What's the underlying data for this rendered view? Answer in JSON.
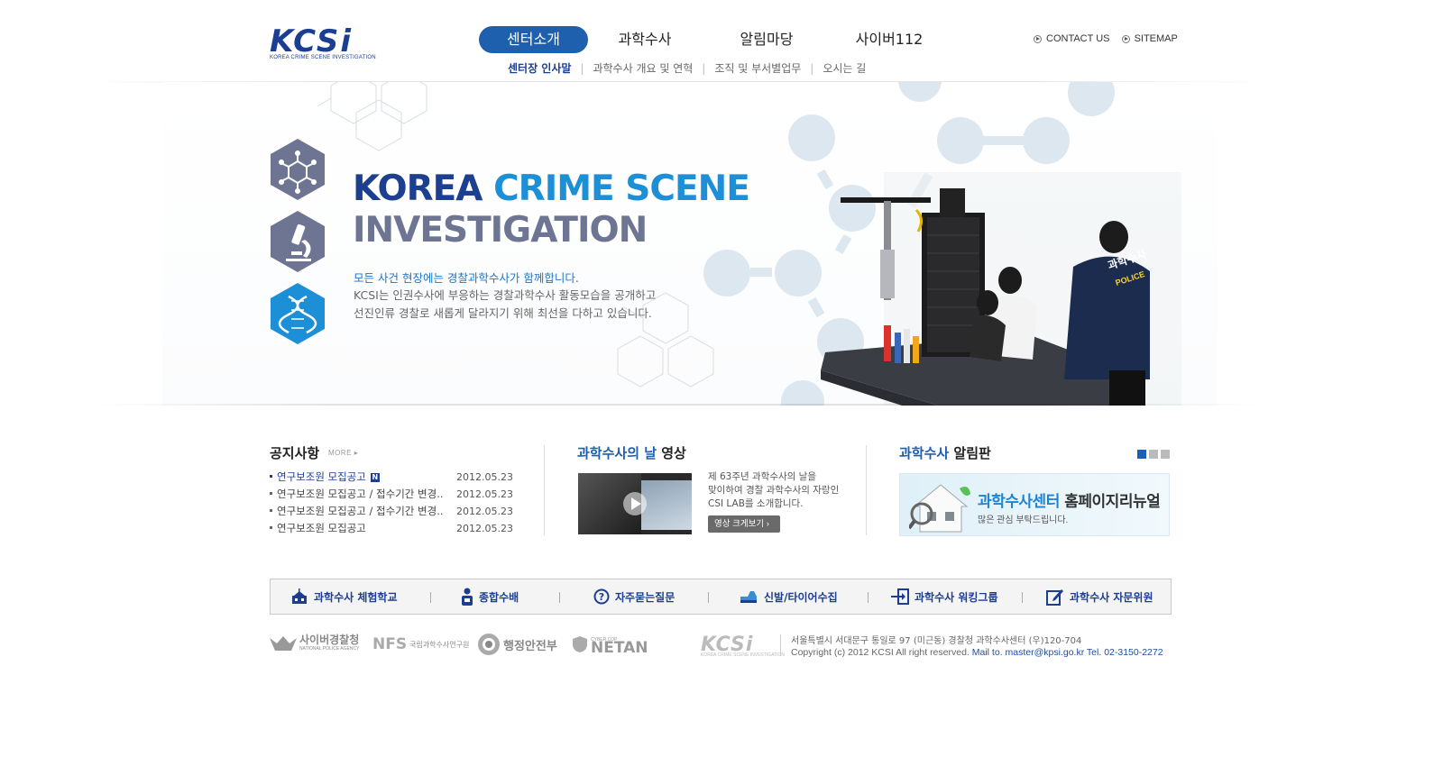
{
  "header": {
    "logo_text": "KCSi",
    "logo_sub": "KOREA CRIME SCENE INVESTIGATION",
    "gnb": [
      {
        "label": "센터소개",
        "active": true
      },
      {
        "label": "과학수사",
        "active": false
      },
      {
        "label": "알림마당",
        "active": false
      },
      {
        "label": "사이버112",
        "active": false
      }
    ],
    "util": {
      "contact": "CONTACT US",
      "sitemap": "SITEMAP"
    },
    "lnb": [
      {
        "label": "센터장 인사말",
        "active": true
      },
      {
        "label": "과학수사 개요 및 연혁",
        "active": false
      },
      {
        "label": "조직 및 부서별업무",
        "active": false
      },
      {
        "label": "오시는 길",
        "active": false
      }
    ]
  },
  "hero": {
    "title_a": "KOREA ",
    "title_b": "CRIME SCENE",
    "title_2": "INVESTIGATION",
    "lead": "모든 사건 현장에는 경찰과학수사가 함께합니다.",
    "desc_1": "KCSI는 인권수사에 부응하는 경찰과학수사 활동모습을 공개하고",
    "desc_2": "선진인류 경찰로 새롭게 달라지기 위해 최선을 다하고 있습니다.",
    "vest_text": "과학수사",
    "vest_sub": "POLICE"
  },
  "notice": {
    "title": "공지사항",
    "more": "MORE",
    "new_badge": "N",
    "items": [
      {
        "title": "연구보조원 모집공고",
        "date": "2012.05.23",
        "is_new": true
      },
      {
        "title": "연구보조원 모집공고 / 접수기간 변경..",
        "date": "2012.05.23",
        "is_new": false
      },
      {
        "title": "연구보조원 모집공고 / 접수기간 변경..",
        "date": "2012.05.23",
        "is_new": false
      },
      {
        "title": "연구보조원 모집공고",
        "date": "2012.05.23",
        "is_new": false
      }
    ]
  },
  "video": {
    "title_hl": "과학수사의 날",
    "title_rest": " 영상",
    "text_1": "제 63주년 과학수사의 날을",
    "text_2": "맞이하여 경찰 과학수사의 자랑인",
    "text_3": "CSI LAB를 소개합니다.",
    "button": "영상 크게보기"
  },
  "board": {
    "title_hl": "과학수사",
    "title_rest": " 알림판",
    "banner_hl": "과학수사센터",
    "banner_rest": " 홈페이지리뉴얼",
    "banner_sub": "많은 관심 부탁드립니다."
  },
  "quick_links": [
    {
      "label": "과학수사 체험학교",
      "icon": "school-icon"
    },
    {
      "label": "종합수배",
      "icon": "wanted-person-icon"
    },
    {
      "label": "자주묻는질문",
      "icon": "question-icon"
    },
    {
      "label": "신발/타이어수집",
      "icon": "shoe-icon"
    },
    {
      "label": "과학수사 워킹그룹",
      "icon": "login-icon"
    },
    {
      "label": "과학수사 자문위원",
      "icon": "edit-icon"
    }
  ],
  "footer": {
    "partners": [
      {
        "name": "사이버경찰청",
        "sub": "NATIONAL POLICE AGENCY"
      },
      {
        "name": "NFS",
        "sub": "국립과학수사연구원"
      },
      {
        "name": "행정안전부",
        "sub": ""
      },
      {
        "name": "NETAN",
        "sub": "CYBER COP"
      }
    ],
    "logo": "KCSi",
    "logo_sub": "KOREA CRIME SCENE INVESTIGATION",
    "address": "서울특별시 서대문구 통일로 97 (미근동) 경찰청 과학수사센터 (우)120-704",
    "copyright": "Copyright (c) 2012 KCSI All right reserved.",
    "contact": "Mail to. master@kpsi.go.kr Tel. 02-3150-2272"
  },
  "colors": {
    "brand": "#1b3e93",
    "accent": "#1e5fae",
    "light_blue": "#1c8fd6"
  }
}
